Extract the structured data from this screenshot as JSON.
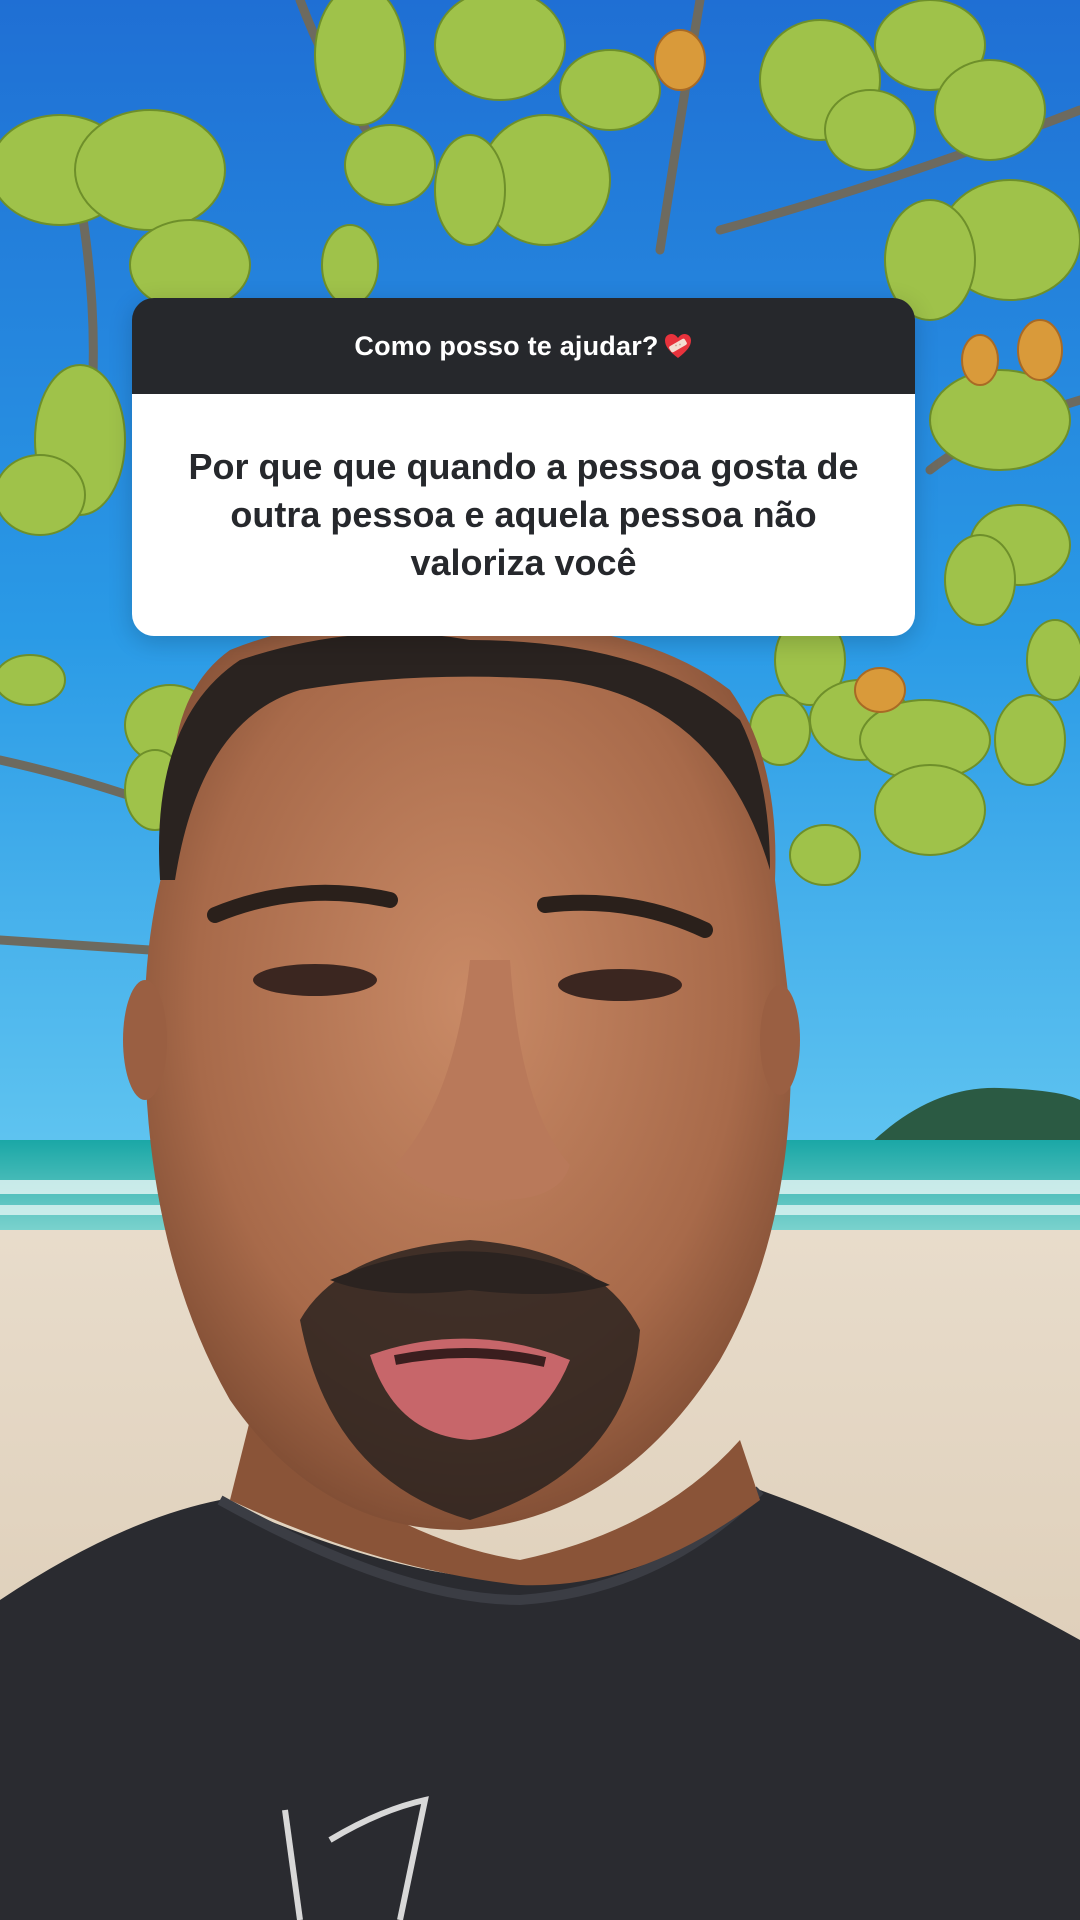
{
  "story": {
    "question_prompt": "Como posso te ajudar?",
    "question_prompt_icon": "heart-bandage-icon",
    "question_text": "Por que que quando a pessoa gosta de outra pessoa e aquela pessoa não valoriza você"
  },
  "colors": {
    "sticker_header_bg": "#26282c",
    "sticker_body_bg": "#ffffff",
    "sticker_text": "#26282c",
    "heart": "#e8323c"
  }
}
